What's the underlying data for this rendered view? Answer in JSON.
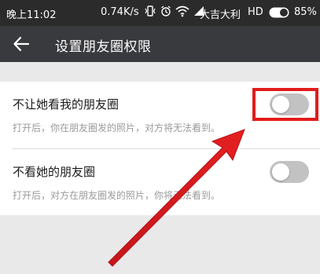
{
  "statusbar": {
    "time": "晚上11:02",
    "speed": "0.74K/s",
    "carrier": "大吉大利",
    "network": "HD",
    "battery": "85%"
  },
  "appbar": {
    "back_icon": "back-arrow-icon",
    "title": "设置朋友圈权限"
  },
  "settings": [
    {
      "title": "不让她看我的朋友圈",
      "description": "打开后，你在朋友圈发的照片，对方将无法看到。",
      "enabled": false
    },
    {
      "title": "不看她的朋友圈",
      "description": "打开后，对方在朋友圈发的照片，你将无法看到。",
      "enabled": false
    }
  ],
  "colors": {
    "appbar": "#393a3e",
    "statusbar": "#2b2b2b",
    "annotation": "#e21b1b",
    "toggle_off": "#c2c2c2",
    "background": "#e9e9e9"
  }
}
